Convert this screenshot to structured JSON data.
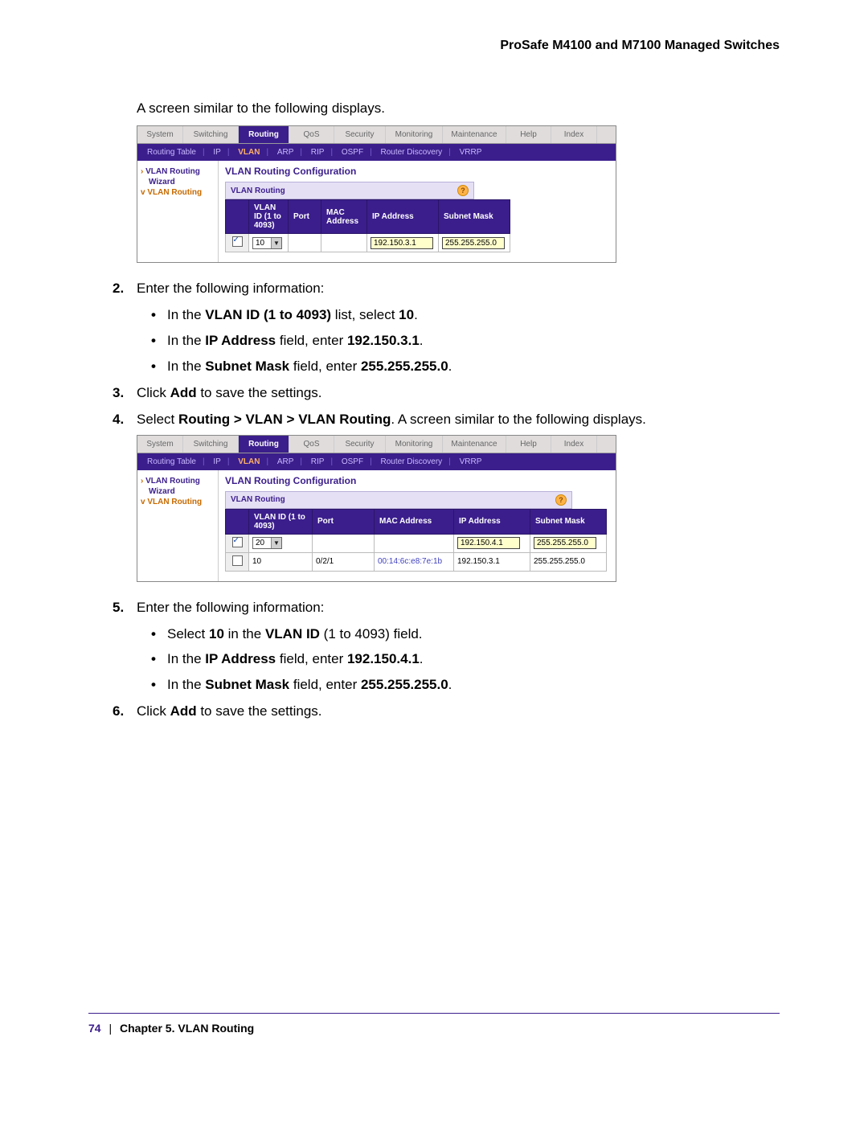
{
  "header": {
    "title": "ProSafe M4100 and M7100 Managed Switches"
  },
  "intro": "A screen similar to the following displays.",
  "tabs": {
    "system": "System",
    "switching": "Switching",
    "routing": "Routing",
    "qos": "QoS",
    "security": "Security",
    "monitoring": "Monitoring",
    "maintenance": "Maintenance",
    "help": "Help",
    "index": "Index"
  },
  "submenu": {
    "routing_table": "Routing Table",
    "ip": "IP",
    "vlan": "VLAN",
    "arp": "ARP",
    "rip": "RIP",
    "ospf": "OSPF",
    "router_discovery": "Router Discovery",
    "vrrp": "VRRP"
  },
  "sidebar": {
    "wizard": "VLAN Routing",
    "wizard2": "Wizard",
    "routing": "VLAN Routing"
  },
  "panel": {
    "title": "VLAN Routing Configuration",
    "bar": "VLAN Routing",
    "help": "?"
  },
  "shot1": {
    "col_vlan": "VLAN ID (1 to 4093)",
    "col_port": "Port",
    "col_mac": "MAC Address",
    "col_ip": "IP Address",
    "col_mask": "Subnet Mask",
    "dd_val": "10",
    "ip_val": "192.150.3.1",
    "mask_val": "255.255.255.0"
  },
  "step2": {
    "num": "2.",
    "text": "Enter the following information:",
    "b1_pre": "In the ",
    "b1_bold": "VLAN ID (1 to 4093)",
    "b1_mid": " list, select ",
    "b1_val": "10",
    "b1_post": ".",
    "b2_pre": "In the ",
    "b2_bold": "IP Address",
    "b2_mid": " field, enter ",
    "b2_val": "192.150.3.1",
    "b2_post": ".",
    "b3_pre": "In the ",
    "b3_bold": "Subnet Mask",
    "b3_mid": " field, enter ",
    "b3_val": "255.255.255.0",
    "b3_post": "."
  },
  "step3": {
    "num": "3.",
    "pre": "Click ",
    "bold": "Add",
    "post": " to save the settings."
  },
  "step4": {
    "num": "4.",
    "pre": "Select ",
    "bold": "Routing > VLAN > VLAN Routing",
    "post": ". A screen similar to the following displays."
  },
  "shot2": {
    "col_vlan": "VLAN ID (1 to 4093)",
    "col_port": "Port",
    "col_mac": "MAC Address",
    "col_ip": "IP Address",
    "col_mask": "Subnet Mask",
    "r1_dd": "20",
    "r1_ip": "192.150.4.1",
    "r1_mask": "255.255.255.0",
    "r2_vlan": "10",
    "r2_port": "0/2/1",
    "r2_mac": "00:14:6c:e8:7e:1b",
    "r2_ip": "192.150.3.1",
    "r2_mask": "255.255.255.0"
  },
  "step5": {
    "num": "5.",
    "text": "Enter the following information:",
    "b1_pre": "Select ",
    "b1_val": "10",
    "b1_mid": " in the ",
    "b1_bold": "VLAN ID",
    "b1_post": " (1 to 4093) field.",
    "b2_pre": "In the ",
    "b2_bold": "IP Address",
    "b2_mid": " field, enter ",
    "b2_val": "192.150.4.1",
    "b2_post": ".",
    "b3_pre": "In the ",
    "b3_bold": "Subnet Mask",
    "b3_mid": " field, enter ",
    "b3_val": "255.255.255.0",
    "b3_post": "."
  },
  "step6": {
    "num": "6.",
    "pre": "Click ",
    "bold": "Add",
    "post": " to save the settings."
  },
  "footer": {
    "page": "74",
    "chapter": "Chapter 5.  VLAN Routing"
  }
}
